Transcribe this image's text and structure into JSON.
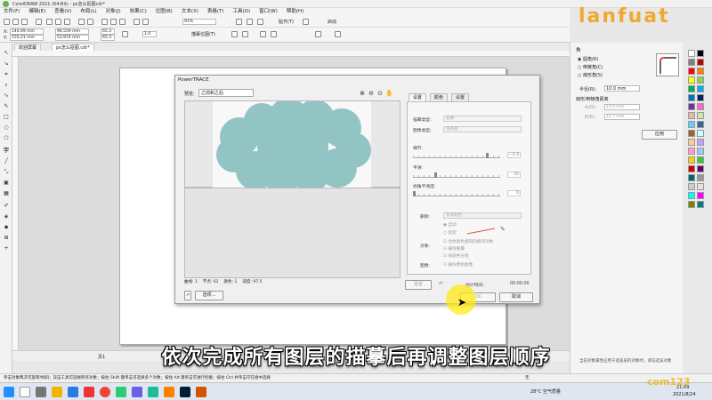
{
  "app": {
    "title": "CorelDRAW 2021 (64-Bit) - ps怎么抠图cdr*"
  },
  "menu": [
    "文件(F)",
    "编辑(E)",
    "查看(V)",
    "布局(L)",
    "对象(J)",
    "效果(C)",
    "位图(B)",
    "文本(X)",
    "表格(T)",
    "工具(O)",
    "窗口(W)",
    "帮助(H)"
  ],
  "toolbar": {
    "zoom": "91%",
    "snap_label": "贴齐(T)",
    "launch_label": "启动",
    "x": "144.69 mm",
    "y": "155.21 mm",
    "w": "96.559 mm",
    "h": "53.974 mm",
    "scale_w": "65.3",
    "scale_h": "65.3",
    "trace_label": "描摹位图(T)",
    "paper_field": "1.0",
    "outline_label": "0.25 pt"
  },
  "tabs": [
    {
      "label": "欢迎屏幕"
    },
    {
      "label": "ps怎么抠图.cdr*"
    }
  ],
  "dialog": {
    "title": "PowerTRACE",
    "preview_label": "预览:",
    "preview_option": "之前和之后",
    "stats": {
      "curves_label": "曲线:",
      "curves_value": "1",
      "nodes_label": "节点:",
      "nodes_value": "61",
      "colors_label": "颜色:",
      "colors_value": "1",
      "accuracy_label": "适度:",
      "accuracy_value": "97.5"
    },
    "options_button": "选项...",
    "tabs": [
      "设置",
      "颜色",
      "设置"
    ],
    "trace_type_label": "描摹类型:",
    "trace_type_value": "轮廓",
    "image_type_label": "图像类型:",
    "image_type_value": "线条图",
    "detail_label": "细节:",
    "detail_value": "—2.4",
    "smooth_label": "平滑:",
    "smooth_value": "25",
    "corner_label": "拐角平滑度:",
    "corner_value": "0",
    "remove_label": "删除:",
    "remove_value": "背景颜色",
    "auto_label": "自动",
    "specify_label": "指定",
    "objects_label": "对象:",
    "merge_adjacent": "合并颜色相同的相邻对象",
    "remove_overlap": "删除重叠",
    "group_by_color": "按颜色分组",
    "image_label": "图像:",
    "remove_orig": "删除原始图像",
    "reset_button": "重置",
    "estimate_label": "估计时间:",
    "estimate_value": "00:00:00",
    "ok_button": "OK",
    "cancel_button": "取消"
  },
  "right_panel": {
    "title": "角",
    "options": [
      "圆角(R)",
      "倒棱角(C)",
      "扇形角(S)"
    ],
    "radius_label": "半径(R):",
    "radius_value": "10.0 mm",
    "distance_label": "扇形/倒棱角距离",
    "r1_label": "A(D):",
    "r1_value": "10.0 mm",
    "r2_label": "B(E):",
    "r2_value": "12.7 mm",
    "apply_button": "应用",
    "tip": "当前对象属性应用于遮盖层的对象时，请勾选该对象"
  },
  "page_tab": "页1",
  "statusbar": "单击对象两次可旋转/倾斜；双击工具可选择所有对象；按住 Shift 键单击可选择多个对象；按住 Alt 键单击可进行挖掘；按住 Ctrl 并单击可在组中选择",
  "status_right": "无",
  "subtitle": "依次完成所有图层的描摹后再调整图层顺序",
  "taskbar": {
    "weather": "28°C 空气质量",
    "time": "21:09",
    "date": "2021/8/24"
  },
  "watermarks": {
    "top": "lanfuat",
    "bottom": "com123"
  },
  "colors": {
    "cloud": "#93c4c4",
    "palette": [
      "#ffffff",
      "#000000",
      "#7f7f7f",
      "#c00000",
      "#ff0000",
      "#ff7f00",
      "#ffff00",
      "#92d050",
      "#00b050",
      "#00b0f0",
      "#0070c0",
      "#002060",
      "#7030a0",
      "#ff66cc",
      "#e6b8a2",
      "#c9e7a9",
      "#66ccff",
      "#336699",
      "#996633",
      "#ccffff",
      "#ffcc99",
      "#cc99ff",
      "#ff99cc",
      "#99ccff",
      "#ffcc00",
      "#33cc33",
      "#cc0000",
      "#660066",
      "#006666",
      "#999999",
      "#cccccc",
      "#f2dcdb",
      "#00ffff",
      "#ff00ff",
      "#808000",
      "#008080"
    ]
  }
}
